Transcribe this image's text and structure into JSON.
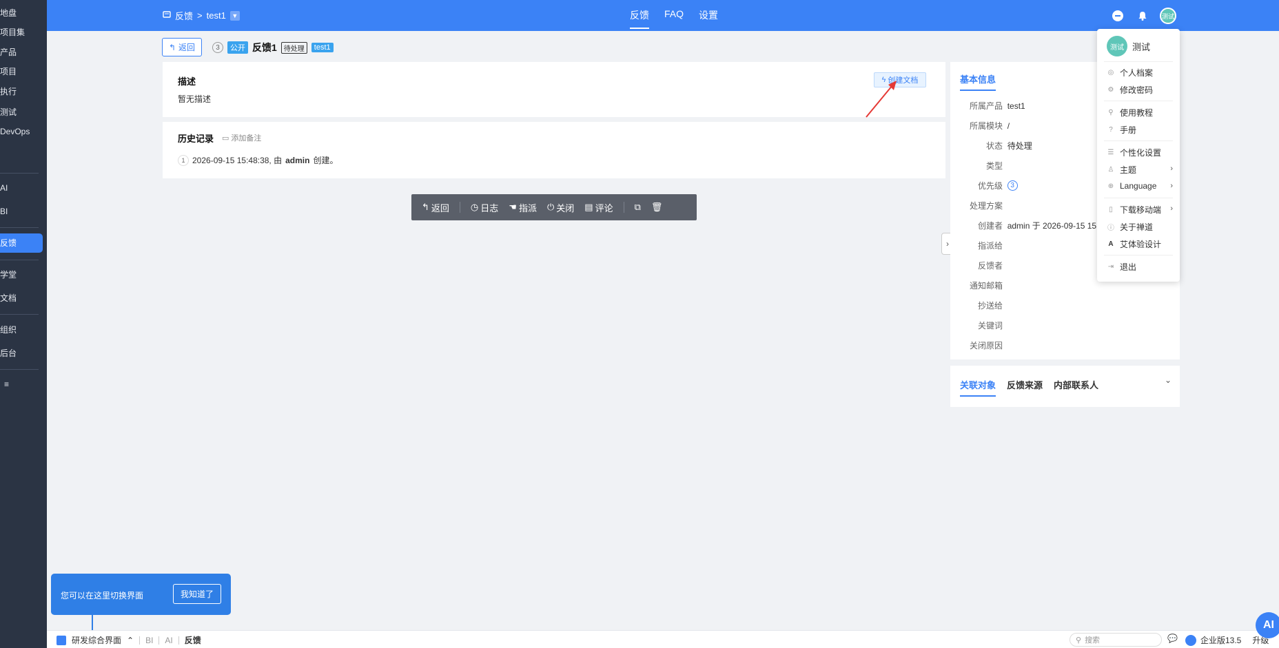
{
  "sidebar": {
    "items": [
      {
        "label": "地盘"
      },
      {
        "label": "项目集"
      },
      {
        "label": "产品"
      },
      {
        "label": "项目"
      },
      {
        "label": "执行"
      },
      {
        "label": "测试"
      },
      {
        "label": "DevOps"
      },
      {
        "label": "AI"
      },
      {
        "label": "BI"
      },
      {
        "label": "反馈",
        "active": true
      },
      {
        "label": "学堂"
      },
      {
        "label": "文档"
      },
      {
        "label": "组织"
      },
      {
        "label": "后台"
      },
      {
        "label": "≡"
      }
    ]
  },
  "topbar": {
    "breadcrumb": {
      "module": "反馈",
      "separator": ">",
      "product": "test1"
    },
    "nav": [
      {
        "label": "反馈",
        "active": true
      },
      {
        "label": "FAQ"
      },
      {
        "label": "设置"
      }
    ],
    "avatar_text": "测试"
  },
  "header": {
    "back_label": "返回",
    "id": "3",
    "visibility": "公开",
    "title": "反馈1",
    "status": "待处理",
    "product_tag": "test1"
  },
  "description": {
    "heading": "描述",
    "value": "暂无描述",
    "create_doc_label": "创建文档"
  },
  "history": {
    "heading": "历史记录",
    "add_note_label": "添加备注",
    "entries": [
      {
        "num": "1",
        "time": "2026-09-15 15:48:38, 由 ",
        "user": "admin",
        "action": " 创建。"
      }
    ]
  },
  "actions": {
    "back": "返回",
    "log": "日志",
    "assign": "指派",
    "close": "关闭",
    "comment": "评论"
  },
  "info": {
    "tab": "基本信息",
    "rows": [
      {
        "key": "所属产品",
        "value": "test1"
      },
      {
        "key": "所属模块",
        "value": "/"
      },
      {
        "key": "状态",
        "value": "待处理"
      },
      {
        "key": "类型",
        "value": ""
      },
      {
        "key": "优先级",
        "value": "3"
      },
      {
        "key": "处理方案",
        "value": ""
      },
      {
        "key": "创建者",
        "value": "admin  于  2026-09-15 15"
      },
      {
        "key": "指派给",
        "value": ""
      },
      {
        "key": "反馈者",
        "value": ""
      },
      {
        "key": "通知邮箱",
        "value": ""
      },
      {
        "key": "抄送给",
        "value": ""
      },
      {
        "key": "关键词",
        "value": ""
      },
      {
        "key": "关闭原因",
        "value": ""
      }
    ]
  },
  "related": {
    "tabs": [
      {
        "label": "关联对象",
        "active": true
      },
      {
        "label": "反馈来源"
      },
      {
        "label": "内部联系人"
      }
    ]
  },
  "user_menu": {
    "avatar_text": "测试",
    "name": "测试",
    "items": [
      {
        "label": "个人档案",
        "icon": "user-icon"
      },
      {
        "label": "修改密码",
        "icon": "gear-icon"
      },
      {
        "label": "使用教程",
        "icon": "pin-icon"
      },
      {
        "label": "手册",
        "icon": "help-icon"
      },
      {
        "label": "个性化设置",
        "icon": "list-icon"
      },
      {
        "label": "主题",
        "icon": "shirt-icon"
      },
      {
        "label": "Language",
        "icon": "globe-icon"
      },
      {
        "label": "下载移动端",
        "icon": "phone-icon"
      },
      {
        "label": "关于禅道",
        "icon": "info-icon"
      },
      {
        "label": "艾体验设计",
        "icon": "a-icon"
      },
      {
        "label": "退出",
        "icon": "exit-icon"
      }
    ]
  },
  "tooltip": {
    "message": "您可以在这里切换界面",
    "confirm": "我知道了"
  },
  "bottombar": {
    "interface": "研发综合界面",
    "bi": "BI",
    "ai": "AI",
    "feedback": "反馈",
    "search_placeholder": "搜索",
    "edition": "企业版13.5",
    "upgrade": "升级"
  },
  "ai_button": "AI",
  "colors": {
    "primary": "#3b82f6",
    "sidebar": "#2b3444",
    "tip": "#2f7fe6"
  }
}
